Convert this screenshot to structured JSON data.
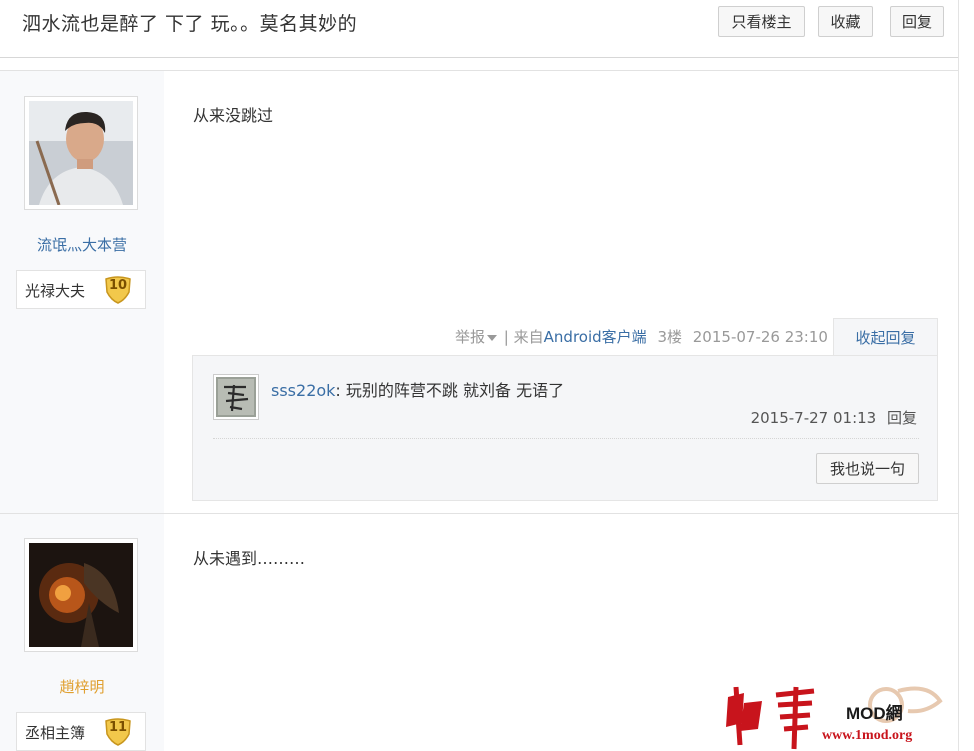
{
  "thread": {
    "title": "泗水流也是醉了 下了 玩。。莫名其妙的",
    "buttons": {
      "only_author": "只看楼主",
      "favorite": "收藏",
      "reply": "回复"
    }
  },
  "posts": [
    {
      "username": "流氓灬大本营",
      "rank": "光禄大夫",
      "level": "10",
      "content": "从来没跳过",
      "meta": {
        "report": "举报",
        "separator": "|",
        "from_prefix": "来自",
        "client": "Android客户端",
        "floor": "3楼",
        "time": "2015-07-26 23:10"
      },
      "collapse_label": "收起回复",
      "comment": {
        "user": "sss22ok",
        "text": ": 玩别的阵营不跳 就刘备 无语了",
        "time": "2015-7-27 01:13",
        "reply_label": "回复"
      },
      "say_button": "我也说一句"
    },
    {
      "username": "趙梓明",
      "rank": "丞相主簿",
      "level": "11",
      "content": "从未遇到………"
    }
  ],
  "watermark": {
    "text": "中華MOD網",
    "url": "www.1mod.org"
  },
  "colors": {
    "link": "#3a6ea5",
    "gold_user": "#e0a030",
    "badge": "#f0c040"
  }
}
